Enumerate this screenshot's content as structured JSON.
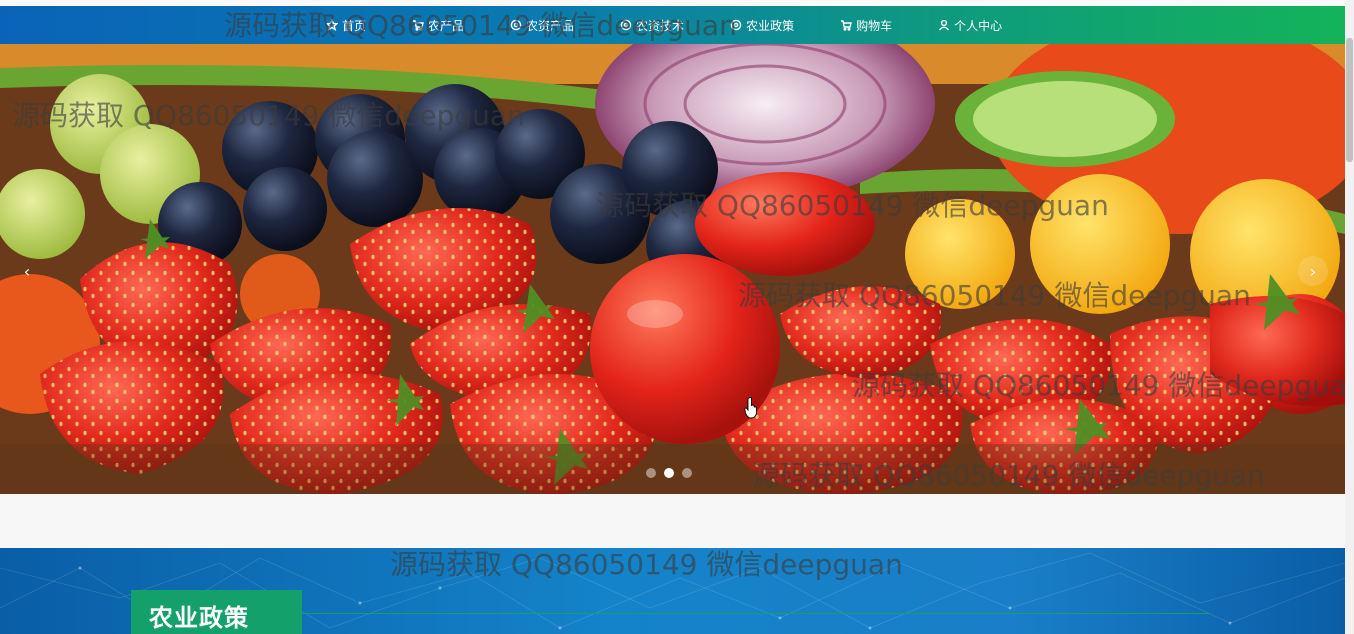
{
  "nav": {
    "items": [
      {
        "label": "首页",
        "icon": "star-icon"
      },
      {
        "label": "农产品",
        "icon": "cart-icon"
      },
      {
        "label": "农资产品",
        "icon": "location-icon"
      },
      {
        "label": "农资技术",
        "icon": "location-icon"
      },
      {
        "label": "农业政策",
        "icon": "location-icon"
      },
      {
        "label": "购物车",
        "icon": "cart-icon"
      },
      {
        "label": "个人中心",
        "icon": "user-icon"
      }
    ]
  },
  "carousel": {
    "prev": "‹",
    "next": "›",
    "active_slide": 2,
    "slide_count": 3
  },
  "section": {
    "title": "农业政策"
  },
  "watermark": {
    "text": "源码获取 QQ86050149 微信deepguan"
  },
  "colors": {
    "nav_start": "#0a63b8",
    "nav_end": "#14b35a",
    "section_tab": "#14a06a",
    "section_bg": "#1483c9"
  }
}
